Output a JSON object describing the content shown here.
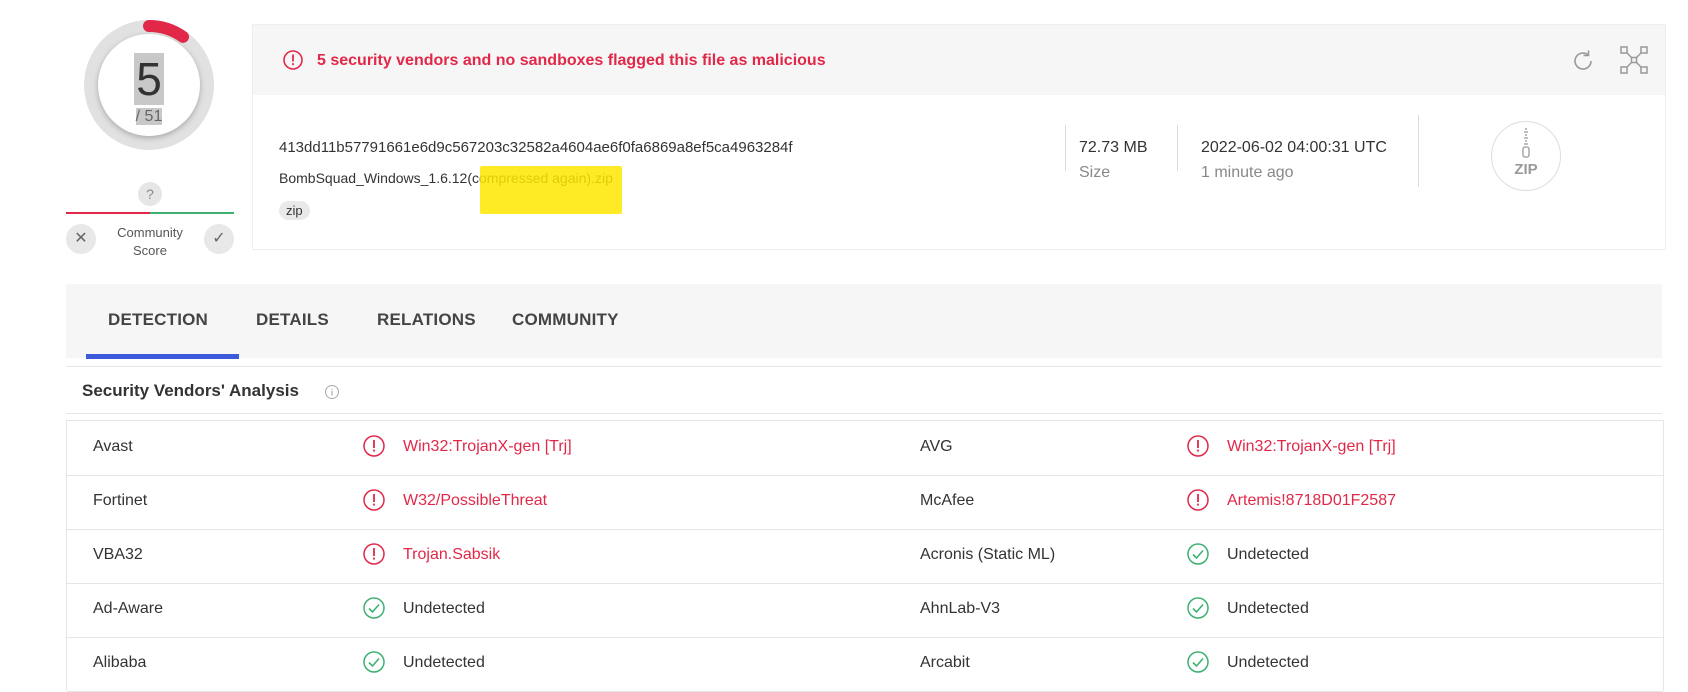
{
  "score": {
    "detected": "5",
    "total": "/ 51",
    "detected_fraction": 0.098
  },
  "community": {
    "question": "?",
    "label_line1": "Community",
    "label_line2": "Score",
    "downvote": "✕",
    "upvote": "✓"
  },
  "alert": {
    "text": "5 security vendors and no sandboxes flagged this file as malicious"
  },
  "file": {
    "hash": "413dd11b57791661e6d9c567203c32582a4604ae6f0fa6869a8ef5ca4963284f",
    "name": "BombSquad_Windows_1.6.12(compressed again).zip",
    "tag": "zip",
    "size_value": "72.73 MB",
    "size_label": "Size",
    "date_value": "2022-06-02 04:00:31 UTC",
    "date_label": "1 minute ago",
    "type_icon_text": "ZIP"
  },
  "tabs": [
    {
      "label": "DETECTION",
      "active": true
    },
    {
      "label": "DETAILS"
    },
    {
      "label": "RELATIONS"
    },
    {
      "label": "COMMUNITY"
    }
  ],
  "section": {
    "title": "Security Vendors' Analysis"
  },
  "vendors": [
    [
      {
        "name": "Avast",
        "result": "Win32:TrojanX-gen [Trj]",
        "status": "malicious"
      },
      {
        "name": "AVG",
        "result": "Win32:TrojanX-gen [Trj]",
        "status": "malicious"
      }
    ],
    [
      {
        "name": "Fortinet",
        "result": "W32/PossibleThreat",
        "status": "malicious"
      },
      {
        "name": "McAfee",
        "result": "Artemis!8718D01F2587",
        "status": "malicious"
      }
    ],
    [
      {
        "name": "VBA32",
        "result": "Trojan.Sabsik",
        "status": "malicious"
      },
      {
        "name": "Acronis (Static ML)",
        "result": "Undetected",
        "status": "clean"
      }
    ],
    [
      {
        "name": "Ad-Aware",
        "result": "Undetected",
        "status": "clean"
      },
      {
        "name": "AhnLab-V3",
        "result": "Undetected",
        "status": "clean"
      }
    ],
    [
      {
        "name": "Alibaba",
        "result": "Undetected",
        "status": "clean"
      },
      {
        "name": "Arcabit",
        "result": "Undetected",
        "status": "clean"
      }
    ]
  ],
  "colors": {
    "malicious": "#e22849",
    "clean": "#3eb072",
    "accent": "#3b5bdb",
    "highlight": "#ffe600"
  },
  "icons": {
    "alert": "alert-circle-icon",
    "refresh": "refresh-icon",
    "expand": "expand-icon",
    "file_type": "zip-file-icon",
    "info": "info-icon",
    "malicious": "alert-circle-icon",
    "clean": "check-circle-icon"
  }
}
